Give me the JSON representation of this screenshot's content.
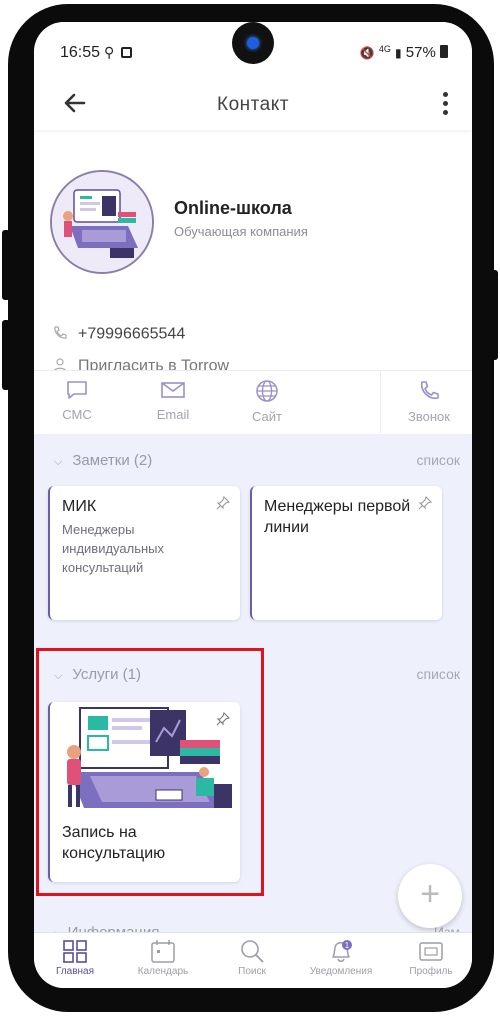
{
  "status": {
    "time": "16:55",
    "network": "4G",
    "battery": "57%"
  },
  "appbar": {
    "title": "Контакт"
  },
  "profile": {
    "name": "Online-школа",
    "subtitle": "Обучающая компания",
    "phone": "+79996665544",
    "invite": "Пригласить в Torrow"
  },
  "actions": [
    {
      "label": "СМС",
      "icon": "message-icon"
    },
    {
      "label": "Email",
      "icon": "envelope-icon"
    },
    {
      "label": "Сайт",
      "icon": "globe-icon"
    },
    {
      "label": "Звонок",
      "icon": "phone-icon"
    }
  ],
  "notes": {
    "title": "Заметки (2)",
    "link": "СПИСОК",
    "items": [
      {
        "title": "МИК",
        "sub": "Менеджеры индивидуальных консультаций"
      },
      {
        "title": "Менеджеры первой линии",
        "sub": ""
      }
    ]
  },
  "services": {
    "title": "Услуги (1)",
    "link": "СПИСОК",
    "items": [
      {
        "title": "Запись на консультацию"
      }
    ]
  },
  "info": {
    "title": "Информация",
    "link": "Изм"
  },
  "fab": {
    "label": "+"
  },
  "bottom_nav": [
    {
      "label": "Главная",
      "icon": "home-grid-icon"
    },
    {
      "label": "Календарь",
      "icon": "calendar-icon"
    },
    {
      "label": "Поиск",
      "icon": "search-icon"
    },
    {
      "label": "Уведомления",
      "icon": "bell-icon",
      "badge": "1"
    },
    {
      "label": "Профиль",
      "icon": "profile-card-icon"
    }
  ],
  "colors": {
    "accent": "#5b4fa0",
    "background": "#eef0fb",
    "highlight": "#e0131c"
  }
}
